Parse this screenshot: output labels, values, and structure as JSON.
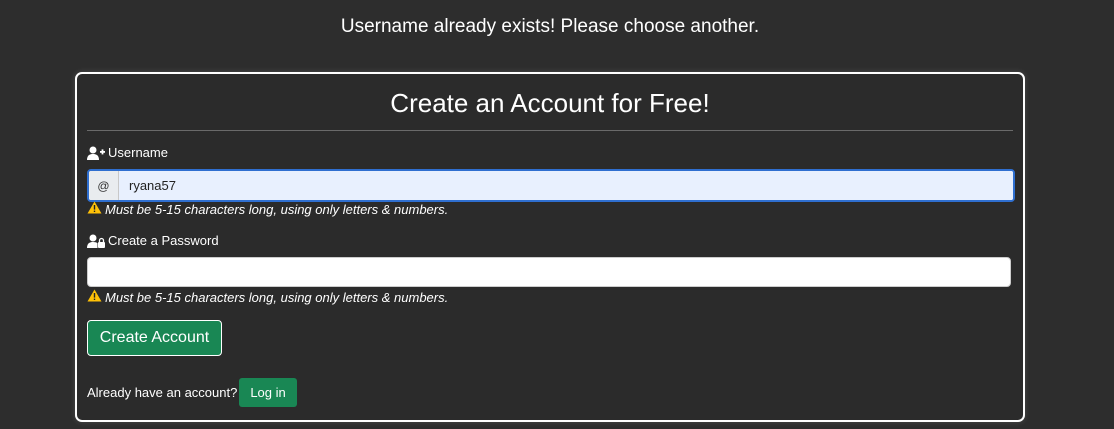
{
  "alert": {
    "message": "Username already exists! Please choose another."
  },
  "card": {
    "title": "Create an Account for Free!"
  },
  "username": {
    "label": "Username",
    "addon": "@",
    "value": "ryana57",
    "hint": "Must be 5-15 characters long, using only letters & numbers.",
    "icon": "user-plus-icon"
  },
  "password": {
    "label": "Create a Password",
    "value": "",
    "hint": "Must be 5-15 characters long, using only letters & numbers.",
    "icon": "user-lock-icon"
  },
  "actions": {
    "create_label": "Create Account",
    "login_prompt": "Already have an account?",
    "login_label": "Log in"
  },
  "colors": {
    "background": "#2d2d2d",
    "accent_green": "#198754",
    "warning_yellow": "#ffc107",
    "input_focus_border": "#2f6fd0",
    "autofill_bg": "#e8f0fe"
  }
}
